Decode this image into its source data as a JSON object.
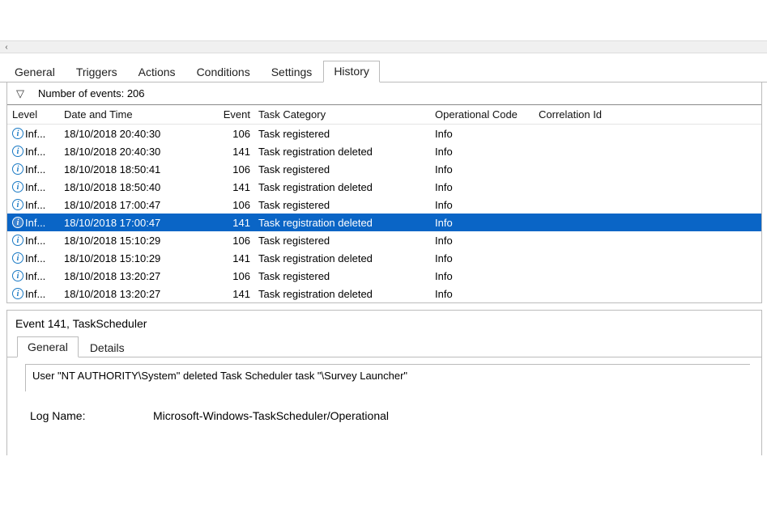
{
  "tabs": {
    "general": "General",
    "triggers": "Triggers",
    "actions": "Actions",
    "conditions": "Conditions",
    "settings": "Settings",
    "history": "History"
  },
  "filter": {
    "label": "Number of events: 206"
  },
  "headers": {
    "level": "Level",
    "date": "Date and Time",
    "event": "Event",
    "category": "Task Category",
    "opcode": "Operational Code",
    "corr": "Correlation Id"
  },
  "events": [
    {
      "level": "Inf...",
      "date": "18/10/2018 20:40:30",
      "eid": "106",
      "cat": "Task registered",
      "op": "Info"
    },
    {
      "level": "Inf...",
      "date": "18/10/2018 20:40:30",
      "eid": "141",
      "cat": "Task registration deleted",
      "op": "Info"
    },
    {
      "level": "Inf...",
      "date": "18/10/2018 18:50:41",
      "eid": "106",
      "cat": "Task registered",
      "op": "Info"
    },
    {
      "level": "Inf...",
      "date": "18/10/2018 18:50:40",
      "eid": "141",
      "cat": "Task registration deleted",
      "op": "Info"
    },
    {
      "level": "Inf...",
      "date": "18/10/2018 17:00:47",
      "eid": "106",
      "cat": "Task registered",
      "op": "Info"
    },
    {
      "level": "Inf...",
      "date": "18/10/2018 17:00:47",
      "eid": "141",
      "cat": "Task registration deleted",
      "op": "Info",
      "selected": true
    },
    {
      "level": "Inf...",
      "date": "18/10/2018 15:10:29",
      "eid": "106",
      "cat": "Task registered",
      "op": "Info"
    },
    {
      "level": "Inf...",
      "date": "18/10/2018 15:10:29",
      "eid": "141",
      "cat": "Task registration deleted",
      "op": "Info"
    },
    {
      "level": "Inf...",
      "date": "18/10/2018 13:20:27",
      "eid": "106",
      "cat": "Task registered",
      "op": "Info"
    },
    {
      "level": "Inf...",
      "date": "18/10/2018 13:20:27",
      "eid": "141",
      "cat": "Task registration deleted",
      "op": "Info"
    }
  ],
  "detail": {
    "title": "Event 141, TaskScheduler",
    "tabs": {
      "general": "General",
      "details": "Details"
    },
    "message": "User \"NT AUTHORITY\\System\"  deleted Task Scheduler task \"\\Survey Launcher\"",
    "log_label": "Log Name:",
    "log_value": "Microsoft-Windows-TaskScheduler/Operational"
  },
  "icons": {
    "filter_glyph": "▽",
    "scroll_left_glyph": "‹",
    "info_glyph": "i"
  }
}
